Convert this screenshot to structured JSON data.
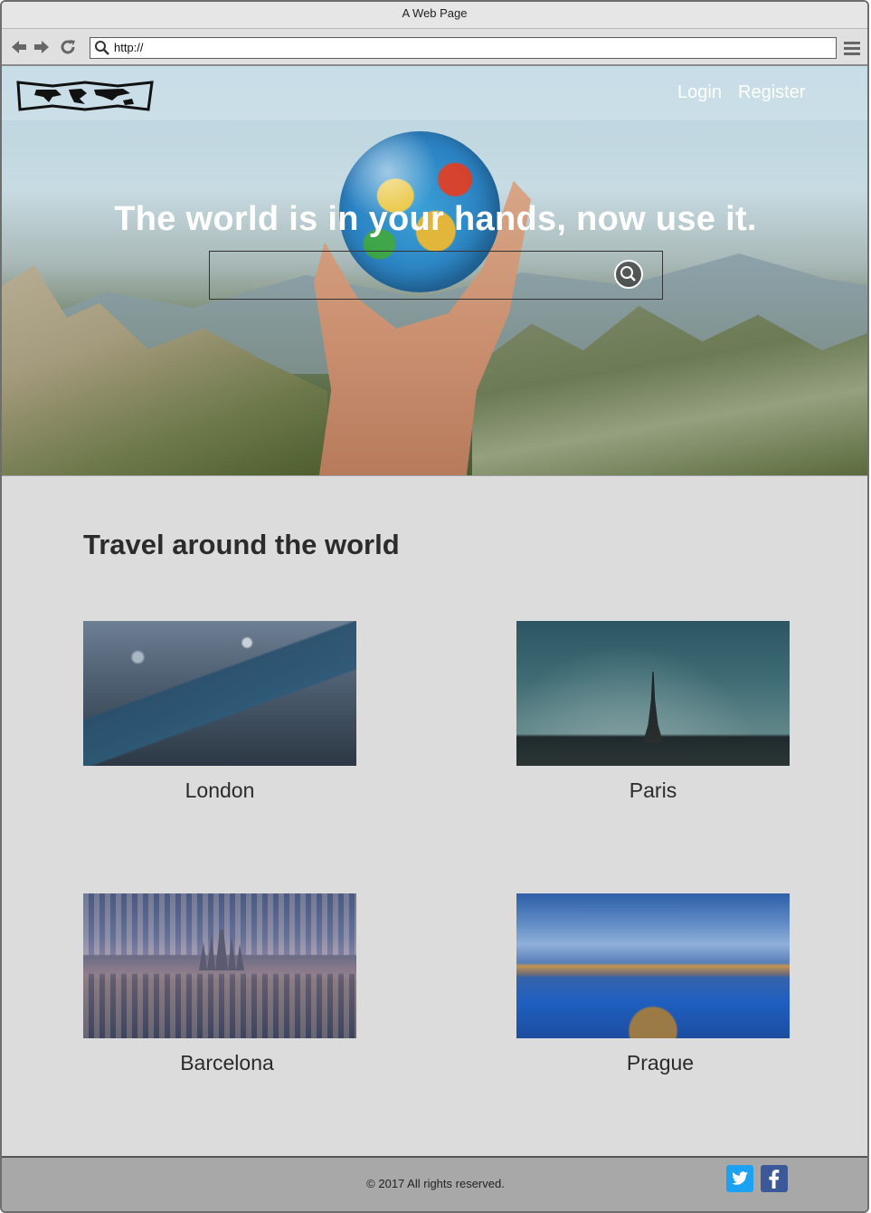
{
  "window": {
    "title": "A Web Page"
  },
  "toolbar": {
    "url": "http://",
    "back_icon": "arrow-left-icon",
    "forward_icon": "arrow-right-icon",
    "reload_icon": "reload-icon",
    "menu_icon": "hamburger-menu-icon"
  },
  "header": {
    "logo_icon": "world-map-logo-icon",
    "nav": {
      "login": "Login",
      "register": "Register"
    }
  },
  "hero": {
    "headline": "The world is in your hands, now use it.",
    "search": {
      "value": "",
      "placeholder": ""
    }
  },
  "main": {
    "section_title": "Travel around the world",
    "destinations": [
      {
        "name": "London"
      },
      {
        "name": "Paris"
      },
      {
        "name": "Barcelona"
      },
      {
        "name": "Prague"
      }
    ]
  },
  "footer": {
    "copyright": "© 2017 All rights reserved.",
    "social": [
      {
        "icon": "twitter-icon",
        "color": "#1da1f2"
      },
      {
        "icon": "facebook-icon",
        "color": "#3b5998"
      }
    ]
  }
}
